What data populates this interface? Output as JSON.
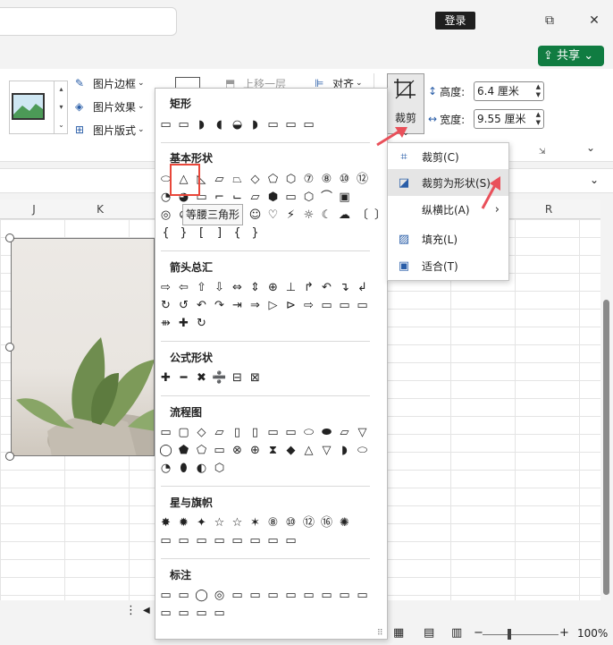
{
  "titlebar": {
    "login_label": "登录",
    "restore_icon": "⧉",
    "close_icon": "✕"
  },
  "share": {
    "label": "共享",
    "chevron": "⌄"
  },
  "ribbon": {
    "border_label": "图片边框",
    "effect_label": "图片效果",
    "layout_label": "图片版式",
    "bring_forward_label": "上移一层",
    "align_label": "对齐",
    "crop_label": "裁剪",
    "height_label": "高度:",
    "height_value": "6.4 厘米",
    "width_label": "宽度:",
    "width_value": "9.55 厘米"
  },
  "columns": {
    "j": "J",
    "k": "K",
    "r": "R"
  },
  "status": {
    "zoom": "100%"
  },
  "gallery": {
    "sections": {
      "rect": "矩形",
      "basic": "基本形状",
      "arrows": "箭头总汇",
      "equation": "公式形状",
      "flowchart": "流程图",
      "stars": "星与旗帜",
      "callouts": "标注"
    },
    "rows": {
      "rect": "▭▭◗◖◒◗▭▭▭",
      "basic1": "⬭△◺▱⏢◇⬠⬡⑦⑧⑩⑫",
      "basic2": "◔◕▭⌐⌙▱⬢▭⬡⌒▣",
      "basic3": "◎⊘⌓▭⬓☺♡⚡☼☾☁〔〕",
      "basic4": "{}[]{}",
      "arrows1": "⇨⇦⇧⇩⇔⇕⊕⊥↱↶↴↲",
      "arrows2": "↻↺↶↷⇥⇒▷⊳⇨▭▭▭",
      "arrows3": "⇻✚↻",
      "equation": "✚━✖➗⊟⊠",
      "flow1": "▭▢◇▱▯▯▭▭⬭⬬▱▽",
      "flow2": "◯⬟⬠▭⊗⊕⧗◆△▽◗⬭",
      "flow3": "◔⬮◐⬡",
      "stars1": "✸✹✦☆☆✶⑧⑩⑫⑯✺",
      "stars2": "▭▭▭▭▭▭▭▭",
      "callouts1": "▭▭◯◎▭▭▭▭▭▭▭▭",
      "callouts2": "▭▭▭▭"
    },
    "tooltip": "等腰三角形"
  },
  "crop_menu": {
    "items": [
      {
        "label": "裁剪(C)",
        "icon": "crop-icon"
      },
      {
        "label": "裁剪为形状(S)",
        "icon": "shape-icon"
      },
      {
        "label": "纵横比(A)",
        "icon": ""
      },
      {
        "label": "填充(L)",
        "icon": "fill-icon"
      },
      {
        "label": "适合(T)",
        "icon": "fit-icon"
      }
    ]
  },
  "colors": {
    "accent": "#107c41",
    "highlight": "#e8473a",
    "arrow": "#e9505a"
  }
}
